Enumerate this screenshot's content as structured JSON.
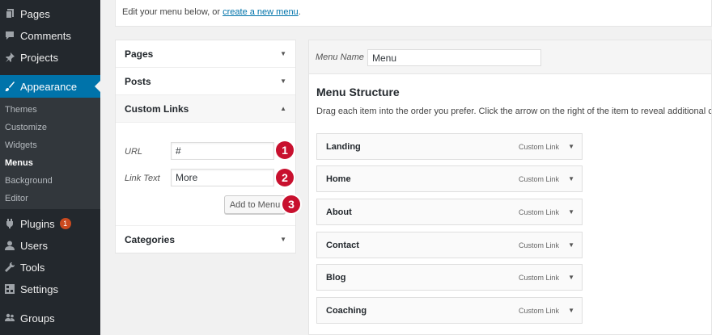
{
  "sidebar": {
    "items": [
      {
        "label": "Pages",
        "icon": "pages-icon"
      },
      {
        "label": "Comments",
        "icon": "comments-icon"
      },
      {
        "label": "Projects",
        "icon": "pin-icon"
      },
      {
        "label": "Appearance",
        "icon": "brush-icon"
      },
      {
        "label": "Plugins",
        "icon": "plugin-icon",
        "badge": "1"
      },
      {
        "label": "Users",
        "icon": "user-icon"
      },
      {
        "label": "Tools",
        "icon": "wrench-icon"
      },
      {
        "label": "Settings",
        "icon": "settings-icon"
      },
      {
        "label": "Groups",
        "icon": "groups-icon"
      }
    ],
    "appearance_submenu": [
      "Themes",
      "Customize",
      "Widgets",
      "Menus",
      "Background",
      "Editor"
    ],
    "current_submenu": "Menus",
    "active_color": "#0073aa",
    "background_color": "#23282d"
  },
  "notice": {
    "prefix": "Edit your menu below, or ",
    "link": "create a new menu",
    "suffix": "."
  },
  "accordion": {
    "sections": [
      {
        "title": "Pages",
        "state": "collapsed"
      },
      {
        "title": "Posts",
        "state": "collapsed"
      },
      {
        "title": "Custom Links",
        "state": "expanded"
      },
      {
        "title": "Categories",
        "state": "collapsed"
      }
    ],
    "custom_links": {
      "url_label": "URL",
      "url_value": "#",
      "link_text_label": "Link Text",
      "link_text_value": "More",
      "add_button": "Add to Menu"
    },
    "steps": [
      "1",
      "2",
      "3"
    ],
    "step_color": "#c8102e"
  },
  "editor": {
    "menu_name_label": "Menu Name",
    "menu_name_value": "Menu",
    "structure_title": "Menu Structure",
    "structure_desc": "Drag each item into the order you prefer. Click the arrow on the right of the item to reveal additional configuration options.",
    "items": [
      {
        "title": "Landing",
        "type": "Custom Link"
      },
      {
        "title": "Home",
        "type": "Custom Link"
      },
      {
        "title": "About",
        "type": "Custom Link"
      },
      {
        "title": "Contact",
        "type": "Custom Link"
      },
      {
        "title": "Blog",
        "type": "Custom Link"
      },
      {
        "title": "Coaching",
        "type": "Custom Link"
      }
    ]
  }
}
